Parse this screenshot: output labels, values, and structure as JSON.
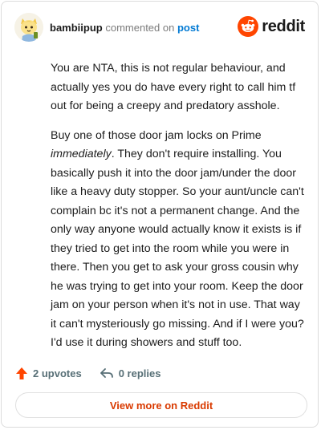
{
  "header": {
    "username": "bambiipup",
    "commented_text": "commented on",
    "post_link": "post",
    "brand": "reddit",
    "brand_color": "#ff4500"
  },
  "comment": {
    "p1": "You are NTA, this is not regular behaviour, and actually yes you do have every right to call him tf out for being a creepy and predatory asshole.",
    "p2_before": "Buy one of those door jam locks on Prime ",
    "p2_emphasis": "immediately",
    "p2_after": ". They don't require installing. You basically push it into the door jam/under the door like a heavy duty stopper. So your aunt/uncle can't complain bc it's not a permanent change. And the only way anyone would actually know it exists is if they tried to get into the room while you were in there. Then you get to ask your gross cousin why he was trying to get into your room. Keep the door jam on your person when it's not in use. That way it can't mysteriously go missing. And if I were you? I'd use it during showers and stuff too."
  },
  "actions": {
    "upvotes": "2 upvotes",
    "replies": "0 replies",
    "upvote_icon": "upvote-arrow-icon",
    "reply_icon": "reply-arrow-icon"
  },
  "footer": {
    "view_more": "View more on Reddit",
    "accent": "#d93a00"
  }
}
